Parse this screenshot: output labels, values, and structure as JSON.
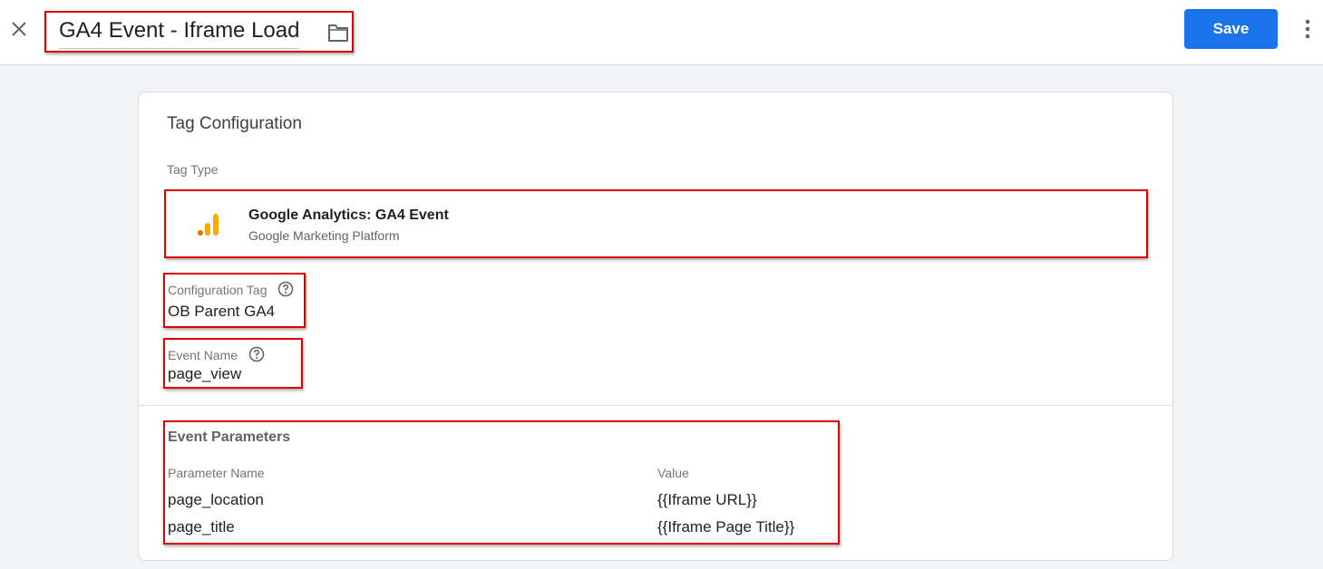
{
  "header": {
    "tag_name": "GA4 Event - Iframe Load",
    "save_label": "Save",
    "icons": [
      "close-icon",
      "folder-icon",
      "more-vert-icon"
    ]
  },
  "card": {
    "title": "Tag Configuration",
    "tag_type_label": "Tag Type",
    "tag_type": {
      "name": "Google Analytics: GA4 Event",
      "provider": "Google Marketing Platform",
      "icon": "google-analytics-icon",
      "icon_color": "#f9ab00"
    },
    "configuration_tag": {
      "label": "Configuration Tag",
      "value": "OB Parent GA4"
    },
    "event_name": {
      "label": "Event Name",
      "value": "page_view"
    },
    "event_parameters": {
      "title": "Event Parameters",
      "columns": [
        "Parameter Name",
        "Value"
      ],
      "rows": [
        {
          "name": "page_location",
          "value": "{{Iframe URL}}"
        },
        {
          "name": "page_title",
          "value": "{{Iframe Page Title}}"
        }
      ]
    }
  },
  "colors": {
    "accent": "#1a73e8",
    "highlight": "#e00000",
    "background": "#f1f3f4"
  }
}
